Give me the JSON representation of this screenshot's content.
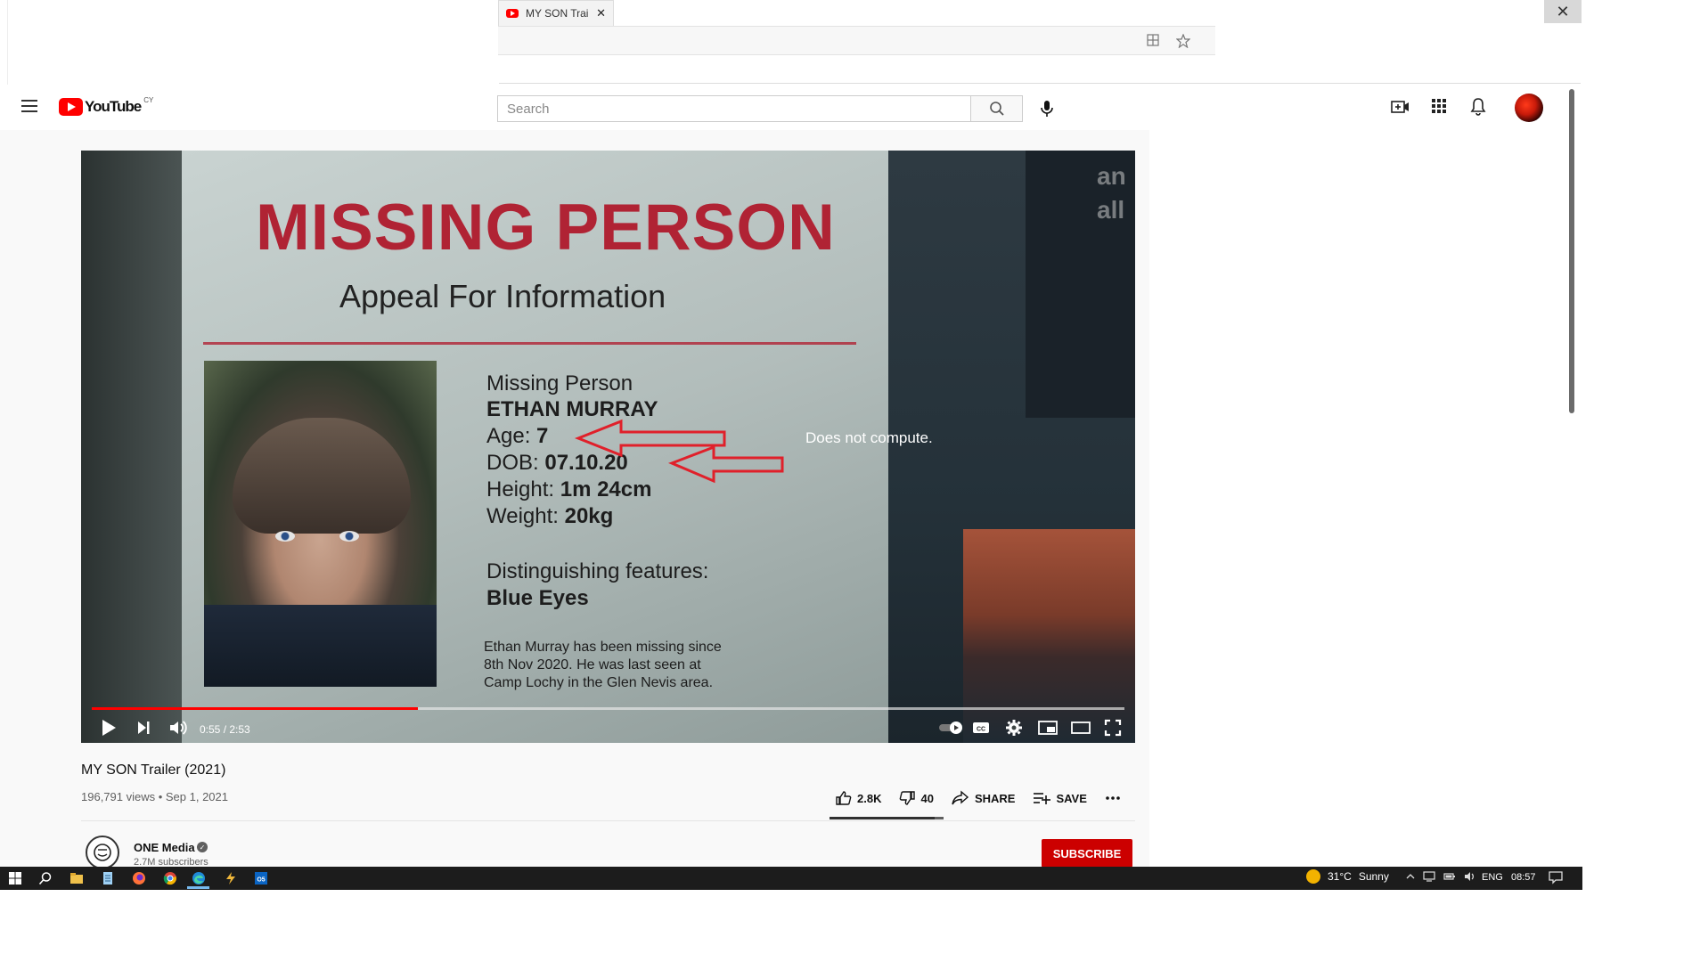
{
  "browser": {
    "tab_title": "MY SON Trailer",
    "close_glyph": "✕",
    "window_close_glyph": "✕"
  },
  "header": {
    "logo_text": "YouTube",
    "logo_country": "CY",
    "search_placeholder": "Search"
  },
  "video": {
    "poster": {
      "headline": "MISSING PERSON",
      "subheadline": "Appeal For Information",
      "label": "Missing Person",
      "name": "ETHAN MURRAY",
      "age_label": "Age:",
      "age_value": "7",
      "dob_label": "DOB:",
      "dob_value": "07.10.20",
      "height_label": "Height:",
      "height_value": "1m 24cm",
      "weight_label": "Weight:",
      "weight_value": "20kg",
      "features_label": "Distinguishing features:",
      "features_value": "Blue Eyes",
      "description": "Ethan Murray has been missing since\n8th Nov 2020. He was last seen at\nCamp Lochy in the Glen Nevis area.",
      "corner_text_1": "an",
      "corner_text_2": "all"
    },
    "annotation_caption": "Does not compute.",
    "time": "0:55 / 2:53",
    "progress_fraction": 0.316,
    "title": "MY SON Trailer (2021)",
    "meta": "196,791 views • Sep 1, 2021",
    "likes": "2.8K",
    "dislikes": "40",
    "share_label": "SHARE",
    "save_label": "SAVE"
  },
  "channel": {
    "name": "ONE Media",
    "subscribers": "2.7M subscribers",
    "subscribe_label": "SUBSCRIBE"
  },
  "taskbar": {
    "temperature": "31°C",
    "weather": "Sunny",
    "language": "ENG",
    "clock": "08:57"
  },
  "colors": {
    "youtube_red": "#ff0000",
    "subscribe_red": "#cc0000",
    "poster_red": "#b02334",
    "annotation_arrow": "#e0202a"
  },
  "icons": [
    "menu-icon",
    "search-icon",
    "mic-icon",
    "create-video-icon",
    "apps-grid-icon",
    "bell-icon",
    "play-icon",
    "next-icon",
    "volume-icon",
    "autoplay-toggle-icon",
    "cc-icon",
    "settings-icon",
    "miniplayer-icon",
    "theater-icon",
    "fullscreen-icon",
    "like-icon",
    "dislike-icon",
    "share-icon",
    "save-icon",
    "more-icon",
    "verified-icon",
    "windows-start-icon"
  ]
}
